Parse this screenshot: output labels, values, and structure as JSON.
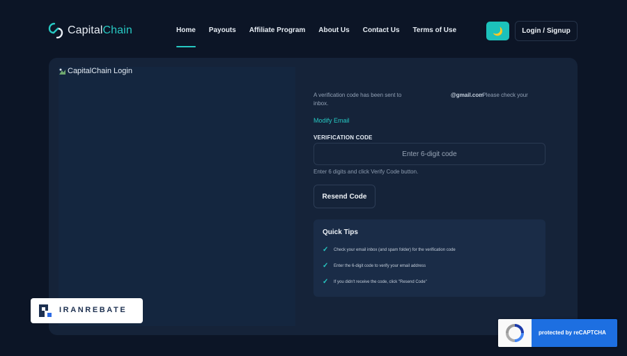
{
  "header": {
    "logo_first": "Capital",
    "logo_second": "Chain",
    "nav": [
      {
        "label": "Home",
        "active": true
      },
      {
        "label": "Payouts",
        "active": false
      },
      {
        "label": "Affiliate Program",
        "active": false
      },
      {
        "label": "About Us",
        "active": false
      },
      {
        "label": "Contact Us",
        "active": false
      },
      {
        "label": "Terms of Use",
        "active": false
      }
    ],
    "theme_icon": "moon-icon",
    "login_label": "Login / Signup"
  },
  "left_panel": {
    "image_alt": "CapitalChain Login"
  },
  "verification": {
    "message_start": "A verification code has been sent to",
    "email_domain": "@gmail.com",
    "message_end": ". Please check your",
    "message_line2": "inbox.",
    "modify_email": "Modify Email",
    "code_label": "VERIFICATION CODE",
    "code_placeholder": "Enter 6-digit code",
    "hint": "Enter 6 digits and click Verify Code button.",
    "resend_label": "Resend Code"
  },
  "tips": {
    "title": "Quick Tips",
    "items": [
      "Check your email inbox (and spam folder) for the verification code",
      "Enter the 6-digit code to verify your email address",
      "If you didn't receive the code, click \"Resend Code\""
    ]
  },
  "badges": {
    "iranrebate": "IRANREBATE",
    "recaptcha": "protected by reCAPTCHA"
  },
  "colors": {
    "background": "#0c1526",
    "card": "#152339",
    "accent": "#27c9c3",
    "recaptcha_blue": "#1d6fe1"
  }
}
